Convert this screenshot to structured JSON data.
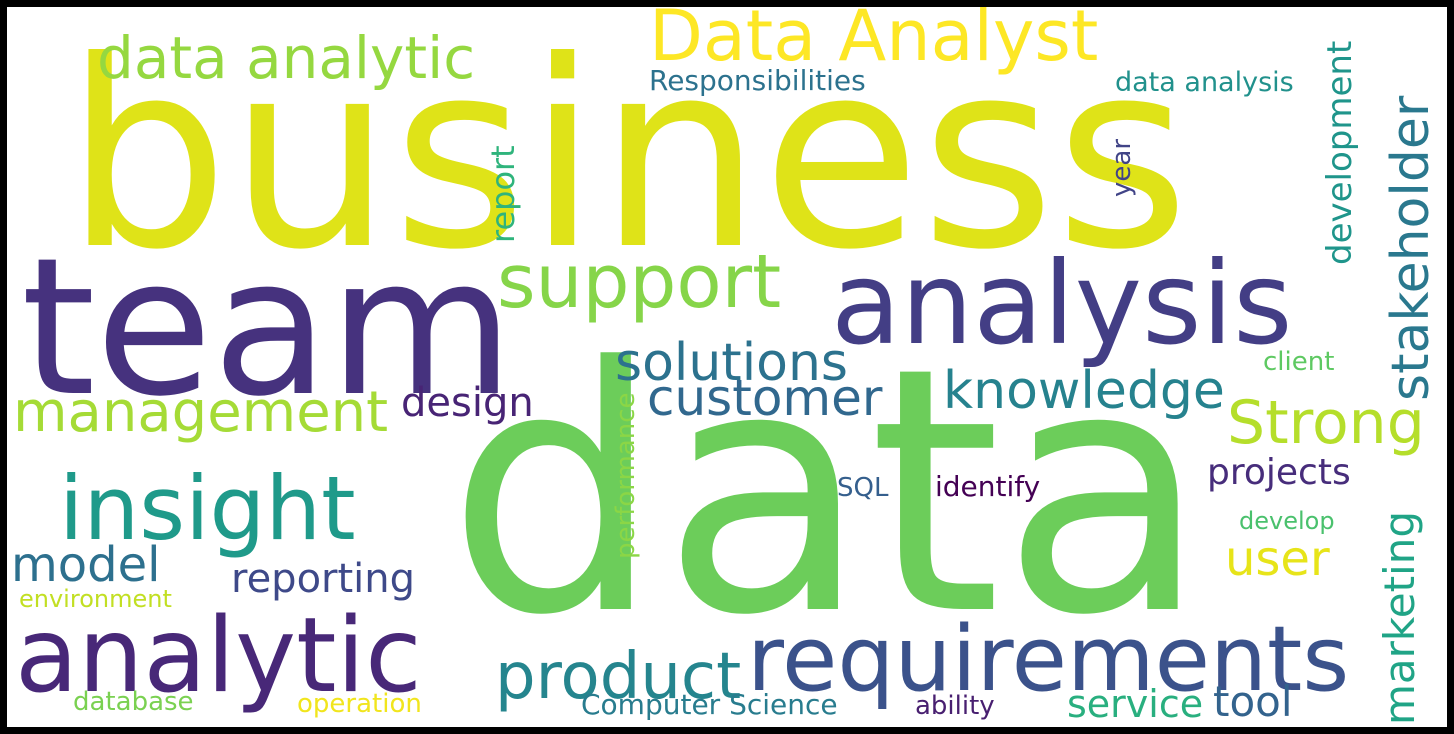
{
  "words": [
    {
      "text": "business",
      "color": "#dfe318",
      "orientation": "horizontal"
    },
    {
      "text": "data",
      "color": "#6ccd5a",
      "orientation": "horizontal"
    },
    {
      "text": "team",
      "color": "#46327e",
      "orientation": "horizontal"
    },
    {
      "text": "analysis",
      "color": "#433e85",
      "orientation": "horizontal"
    },
    {
      "text": "analytic",
      "color": "#482878",
      "orientation": "horizontal"
    },
    {
      "text": "requirements",
      "color": "#3b528b",
      "orientation": "horizontal"
    },
    {
      "text": "insight",
      "color": "#1f9a8a",
      "orientation": "horizontal"
    },
    {
      "text": "support",
      "color": "#86d549",
      "orientation": "horizontal"
    },
    {
      "text": "Data Analyst",
      "color": "#fde725",
      "orientation": "horizontal"
    },
    {
      "text": "data analytic",
      "color": "#95d840",
      "orientation": "horizontal"
    },
    {
      "text": "management",
      "color": "#a5db36",
      "orientation": "horizontal"
    },
    {
      "text": "product",
      "color": "#25858e",
      "orientation": "horizontal"
    },
    {
      "text": "solutions",
      "color": "#2c728e",
      "orientation": "horizontal"
    },
    {
      "text": "customer",
      "color": "#31688e",
      "orientation": "horizontal"
    },
    {
      "text": "knowledge",
      "color": "#26828e",
      "orientation": "horizontal"
    },
    {
      "text": "Strong",
      "color": "#b5de2b",
      "orientation": "horizontal"
    },
    {
      "text": "stakeholder",
      "color": "#2a788e",
      "orientation": "vertical"
    },
    {
      "text": "model",
      "color": "#2d708e",
      "orientation": "horizontal"
    },
    {
      "text": "reporting",
      "color": "#3e4989",
      "orientation": "horizontal"
    },
    {
      "text": "user",
      "color": "#e7e419",
      "orientation": "horizontal"
    },
    {
      "text": "marketing",
      "color": "#20a486",
      "orientation": "vertical"
    },
    {
      "text": "development",
      "color": "#1f958b",
      "orientation": "vertical"
    },
    {
      "text": "design",
      "color": "#482475",
      "orientation": "horizontal"
    },
    {
      "text": "projects",
      "color": "#472d7b",
      "orientation": "horizontal"
    },
    {
      "text": "service",
      "color": "#29af7f",
      "orientation": "horizontal"
    },
    {
      "text": "tool",
      "color": "#33638d",
      "orientation": "horizontal"
    },
    {
      "text": "report",
      "color": "#2fb47c",
      "orientation": "vertical"
    },
    {
      "text": "Responsibilities",
      "color": "#2c728e",
      "orientation": "horizontal"
    },
    {
      "text": "data analysis",
      "color": "#21918c",
      "orientation": "horizontal"
    },
    {
      "text": "Computer Science",
      "color": "#287c8e",
      "orientation": "horizontal"
    },
    {
      "text": "identify",
      "color": "#440154",
      "orientation": "horizontal"
    },
    {
      "text": "SQL",
      "color": "#355f8d",
      "orientation": "horizontal"
    },
    {
      "text": "develop",
      "color": "#4ac16d",
      "orientation": "horizontal"
    },
    {
      "text": "client",
      "color": "#5ec962",
      "orientation": "horizontal"
    },
    {
      "text": "year",
      "color": "#414487",
      "orientation": "vertical"
    },
    {
      "text": "performance",
      "color": "#8bd646",
      "orientation": "vertical"
    },
    {
      "text": "environment",
      "color": "#c2df23",
      "orientation": "horizontal"
    },
    {
      "text": "database",
      "color": "#7ad151",
      "orientation": "horizontal"
    },
    {
      "text": "operation",
      "color": "#f1e51d",
      "orientation": "horizontal"
    },
    {
      "text": "ability",
      "color": "#481f70",
      "orientation": "horizontal"
    }
  ]
}
